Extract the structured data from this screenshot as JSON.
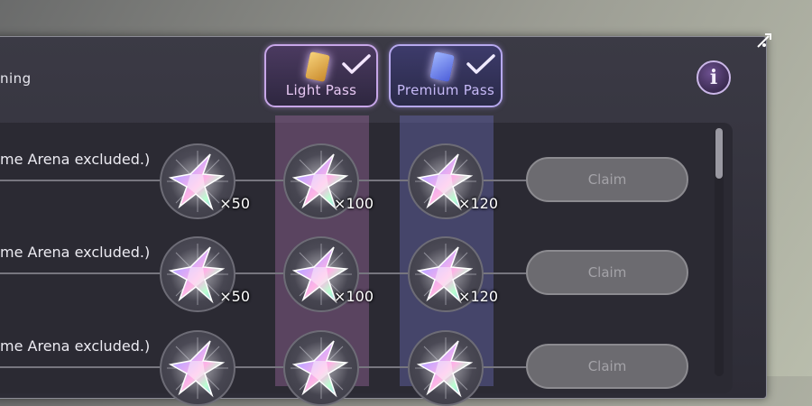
{
  "header": {
    "title": "ning"
  },
  "passes": [
    {
      "label": "Light Pass",
      "checked": true,
      "accent": "#c7a6e8"
    },
    {
      "label": "Premium Pass",
      "checked": true,
      "accent": "#b6a8ee"
    }
  ],
  "rows": [
    {
      "description": "me Arena excluded.)",
      "rewards": [
        {
          "icon": "prism-star-icon",
          "quantity": "×50"
        },
        {
          "icon": "prism-star-icon",
          "quantity": "×100"
        },
        {
          "icon": "prism-star-icon",
          "quantity": "×120"
        }
      ],
      "claim_label": "Claim"
    },
    {
      "description": "me Arena excluded.)",
      "rewards": [
        {
          "icon": "prism-star-icon",
          "quantity": "×50"
        },
        {
          "icon": "prism-star-icon",
          "quantity": "×100"
        },
        {
          "icon": "prism-star-icon",
          "quantity": "×120"
        }
      ],
      "claim_label": "Claim"
    },
    {
      "description": "me Arena excluded.)",
      "rewards": [
        {
          "icon": "prism-star-icon",
          "quantity": ""
        },
        {
          "icon": "prism-star-icon",
          "quantity": ""
        },
        {
          "icon": "prism-star-icon",
          "quantity": ""
        }
      ],
      "claim_label": "Claim"
    }
  ],
  "info_button": {
    "label": "i"
  }
}
